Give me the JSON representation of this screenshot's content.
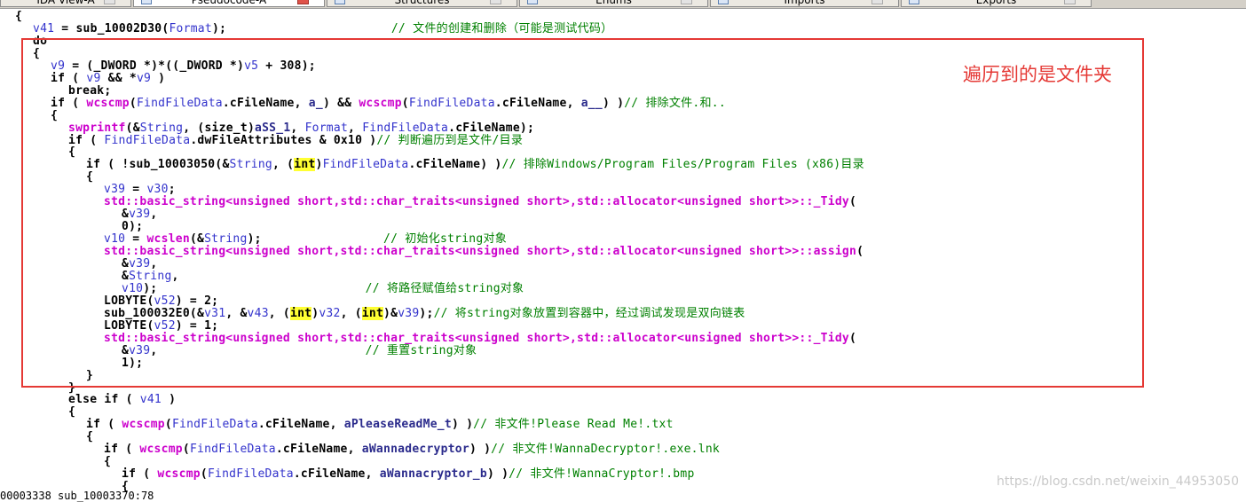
{
  "tabs": [
    {
      "label": "IDA View-A",
      "active": false
    },
    {
      "label": "Pseudocode-A",
      "active": true
    },
    {
      "label": "Structures",
      "active": false
    },
    {
      "label": "Enums",
      "active": false
    },
    {
      "label": "Imports",
      "active": false
    },
    {
      "label": "Exports",
      "active": false
    }
  ],
  "code_lines": [
    {
      "indent": 0,
      "parts": [
        [
          "{",
          "kw"
        ]
      ]
    },
    {
      "indent": 1,
      "parts": [
        [
          "v41",
          "var"
        ],
        [
          " = ",
          "kw"
        ],
        [
          "sub_10002D30",
          "kw"
        ],
        [
          "(",
          "kw"
        ],
        [
          "Format",
          "var"
        ],
        [
          ");",
          "kw"
        ],
        [
          "                       // 文件的创建和删除（可能是测试代码）",
          "cm"
        ]
      ]
    },
    {
      "indent": 1,
      "parts": [
        [
          "do",
          "kw"
        ]
      ]
    },
    {
      "indent": 1,
      "parts": [
        [
          "{",
          "kw"
        ]
      ]
    },
    {
      "indent": 2,
      "parts": [
        [
          "v9",
          "var"
        ],
        [
          " = (_DWORD *)*((_DWORD *)",
          "kw"
        ],
        [
          "v5",
          "var"
        ],
        [
          " + 308);",
          "kw"
        ]
      ]
    },
    {
      "indent": 2,
      "parts": [
        [
          "if ( ",
          "kw"
        ],
        [
          "v9",
          "var"
        ],
        [
          " && *",
          "kw"
        ],
        [
          "v9",
          "var"
        ],
        [
          " )",
          "kw"
        ]
      ]
    },
    {
      "indent": 3,
      "parts": [
        [
          "break;",
          "kw"
        ]
      ]
    },
    {
      "indent": 2,
      "parts": [
        [
          "if ( ",
          "kw"
        ],
        [
          "wcscmp",
          "fn"
        ],
        [
          "(",
          "kw"
        ],
        [
          "FindFileData",
          "var"
        ],
        [
          ".cFileName, ",
          "fld"
        ],
        [
          "a_",
          "str"
        ],
        [
          ") && ",
          "kw"
        ],
        [
          "wcscmp",
          "fn"
        ],
        [
          "(",
          "kw"
        ],
        [
          "FindFileData",
          "var"
        ],
        [
          ".cFileName, ",
          "fld"
        ],
        [
          "a__",
          "str"
        ],
        [
          ") )",
          "kw"
        ],
        [
          "// 排除文件.和..",
          "cm"
        ]
      ]
    },
    {
      "indent": 2,
      "parts": [
        [
          "{",
          "kw"
        ]
      ]
    },
    {
      "indent": 3,
      "parts": [
        [
          "swprintf",
          "fn"
        ],
        [
          "(&",
          "kw"
        ],
        [
          "String",
          "var"
        ],
        [
          ", (size_t)",
          "kw"
        ],
        [
          "aSS_1",
          "str"
        ],
        [
          ", ",
          "kw"
        ],
        [
          "Format",
          "var"
        ],
        [
          ", ",
          "kw"
        ],
        [
          "FindFileData",
          "var"
        ],
        [
          ".cFileName);",
          "fld"
        ]
      ]
    },
    {
      "indent": 3,
      "parts": [
        [
          "if ( ",
          "kw"
        ],
        [
          "FindFileData",
          "var"
        ],
        [
          ".dwFileAttributes & 0x10 )",
          "fld"
        ],
        [
          "// 判断遍历到是文件/目录",
          "cm"
        ]
      ]
    },
    {
      "indent": 3,
      "parts": [
        [
          "{",
          "kw"
        ]
      ]
    },
    {
      "indent": 4,
      "parts": [
        [
          "if ( !",
          "kw"
        ],
        [
          "sub_10003050",
          "kw"
        ],
        [
          "(&",
          "kw"
        ],
        [
          "String",
          "var"
        ],
        [
          ", (",
          "kw"
        ],
        [
          "int",
          "ty"
        ],
        [
          ")",
          "kw"
        ],
        [
          "FindFileData",
          "var"
        ],
        [
          ".cFileName) )",
          "fld"
        ],
        [
          "// 排除Windows/Program Files/Program Files (x86)目录",
          "cm"
        ]
      ]
    },
    {
      "indent": 4,
      "parts": [
        [
          "{",
          "kw"
        ]
      ]
    },
    {
      "indent": 5,
      "parts": [
        [
          "v39",
          "var"
        ],
        [
          " = ",
          "kw"
        ],
        [
          "v30",
          "var"
        ],
        [
          ";",
          "kw"
        ]
      ]
    },
    {
      "indent": 5,
      "parts": [
        [
          "std::basic_string<unsigned short,std::char_traits<unsigned short>,std::allocator<unsigned short>>::_Tidy",
          "fn"
        ],
        [
          "(",
          "kw"
        ]
      ]
    },
    {
      "indent": 6,
      "parts": [
        [
          "&",
          "kw"
        ],
        [
          "v39",
          "var"
        ],
        [
          ",",
          "kw"
        ]
      ]
    },
    {
      "indent": 6,
      "parts": [
        [
          "0);",
          "kw"
        ]
      ]
    },
    {
      "indent": 5,
      "parts": [
        [
          "v10",
          "var"
        ],
        [
          " = ",
          "kw"
        ],
        [
          "wcslen",
          "fn"
        ],
        [
          "(&",
          "kw"
        ],
        [
          "String",
          "var"
        ],
        [
          ");",
          "kw"
        ],
        [
          "                 // 初始化string对象",
          "cm"
        ]
      ]
    },
    {
      "indent": 5,
      "parts": [
        [
          "std::basic_string<unsigned short,std::char_traits<unsigned short>,std::allocator<unsigned short>>::assign",
          "fn"
        ],
        [
          "(",
          "kw"
        ]
      ]
    },
    {
      "indent": 6,
      "parts": [
        [
          "&",
          "kw"
        ],
        [
          "v39",
          "var"
        ],
        [
          ",",
          "kw"
        ]
      ]
    },
    {
      "indent": 6,
      "parts": [
        [
          "&",
          "kw"
        ],
        [
          "String",
          "var"
        ],
        [
          ",",
          "kw"
        ]
      ]
    },
    {
      "indent": 6,
      "parts": [
        [
          "v10",
          "var"
        ],
        [
          ");",
          "kw"
        ],
        [
          "                             // 将路径赋值给string对象",
          "cm"
        ]
      ]
    },
    {
      "indent": 5,
      "parts": [
        [
          "LOBYTE",
          "kw"
        ],
        [
          "(",
          "kw"
        ],
        [
          "v52",
          "var"
        ],
        [
          ") = 2;",
          "kw"
        ]
      ]
    },
    {
      "indent": 5,
      "parts": [
        [
          "sub_100032E0",
          "kw"
        ],
        [
          "(&",
          "kw"
        ],
        [
          "v31",
          "var"
        ],
        [
          ", &",
          "kw"
        ],
        [
          "v43",
          "var"
        ],
        [
          ", (",
          "kw"
        ],
        [
          "int",
          "ty"
        ],
        [
          ")",
          "kw"
        ],
        [
          "v32",
          "var"
        ],
        [
          ", (",
          "kw"
        ],
        [
          "int",
          "ty"
        ],
        [
          ")&",
          "kw"
        ],
        [
          "v39",
          "var"
        ],
        [
          ");",
          "kw"
        ],
        [
          "// 将string对象放置到容器中，经过调试发现是双向链表",
          "cm"
        ]
      ]
    },
    {
      "indent": 5,
      "parts": [
        [
          "LOBYTE",
          "kw"
        ],
        [
          "(",
          "kw"
        ],
        [
          "v52",
          "var"
        ],
        [
          ") = 1;",
          "kw"
        ]
      ]
    },
    {
      "indent": 5,
      "parts": [
        [
          "std::basic_string<unsigned short,std::char_traits<unsigned short>,std::allocator<unsigned short>>::_Tidy",
          "fn"
        ],
        [
          "(",
          "kw"
        ]
      ]
    },
    {
      "indent": 6,
      "parts": [
        [
          "&",
          "kw"
        ],
        [
          "v39",
          "var"
        ],
        [
          ",",
          "kw"
        ],
        [
          "                             // 重置string对象",
          "cm"
        ]
      ]
    },
    {
      "indent": 6,
      "parts": [
        [
          "1);",
          "kw"
        ]
      ]
    },
    {
      "indent": 4,
      "parts": [
        [
          "}",
          "kw"
        ]
      ]
    },
    {
      "indent": 3,
      "parts": [
        [
          "}",
          "kw"
        ]
      ]
    },
    {
      "indent": 3,
      "parts": [
        [
          "else if ( ",
          "kw"
        ],
        [
          "v41",
          "var"
        ],
        [
          " )",
          "kw"
        ]
      ]
    },
    {
      "indent": 3,
      "parts": [
        [
          "{",
          "kw"
        ]
      ]
    },
    {
      "indent": 4,
      "parts": [
        [
          "if ( ",
          "kw"
        ],
        [
          "wcscmp",
          "fn"
        ],
        [
          "(",
          "kw"
        ],
        [
          "FindFileData",
          "var"
        ],
        [
          ".cFileName, ",
          "fld"
        ],
        [
          "aPleaseReadMe_t",
          "str"
        ],
        [
          ") )",
          "kw"
        ],
        [
          "// 非文件!Please Read Me!.txt",
          "cm"
        ]
      ]
    },
    {
      "indent": 4,
      "parts": [
        [
          "{",
          "kw"
        ]
      ]
    },
    {
      "indent": 5,
      "parts": [
        [
          "if ( ",
          "kw"
        ],
        [
          "wcscmp",
          "fn"
        ],
        [
          "(",
          "kw"
        ],
        [
          "FindFileData",
          "var"
        ],
        [
          ".cFileName, ",
          "fld"
        ],
        [
          "aWannadecryptor",
          "str"
        ],
        [
          ") )",
          "kw"
        ],
        [
          "// 非文件!WannaDecryptor!.exe.lnk",
          "cm"
        ]
      ]
    },
    {
      "indent": 5,
      "parts": [
        [
          "{",
          "kw"
        ]
      ]
    },
    {
      "indent": 6,
      "parts": [
        [
          "if ( ",
          "kw"
        ],
        [
          "wcscmp",
          "fn"
        ],
        [
          "(",
          "kw"
        ],
        [
          "FindFileData",
          "var"
        ],
        [
          ".cFileName, ",
          "fld"
        ],
        [
          "aWannacryptor_b",
          "str"
        ],
        [
          ") )",
          "kw"
        ],
        [
          "// 非文件!WannaCryptor!.bmp",
          "cm"
        ]
      ]
    },
    {
      "indent": 6,
      "parts": [
        [
          "{",
          "kw"
        ]
      ]
    }
  ],
  "annotation": "遍历到的是文件夹",
  "status_text": "00003338 sub_10003370:78",
  "watermark": "https://blog.csdn.net/weixin_44953050"
}
